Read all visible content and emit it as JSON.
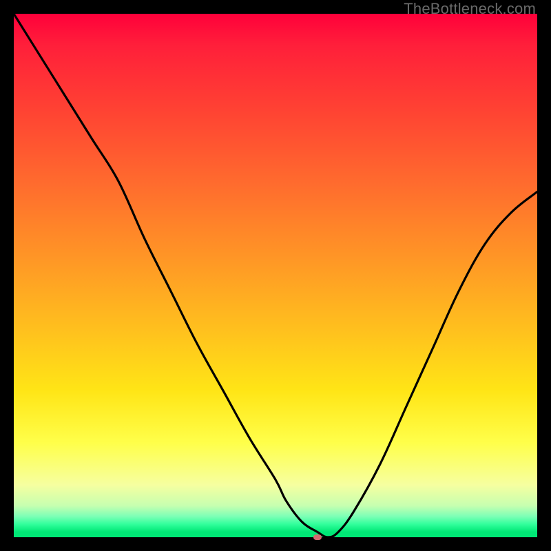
{
  "watermark": "TheBottleneck.com",
  "colors": {
    "curve": "#000000",
    "dot": "#d2686f",
    "frame": "#000000"
  },
  "chart_data": {
    "type": "line",
    "title": "",
    "xlabel": "",
    "ylabel": "",
    "xlim": [
      0,
      100
    ],
    "ylim": [
      0,
      100
    ],
    "series": [
      {
        "name": "curve",
        "x": [
          0,
          5,
          10,
          15,
          20,
          25,
          30,
          35,
          40,
          45,
          50,
          52,
          55,
          58,
          60,
          62,
          65,
          70,
          75,
          80,
          85,
          90,
          95,
          100
        ],
        "y": [
          100,
          92,
          84,
          76,
          68,
          57,
          47,
          37,
          28,
          19,
          11,
          7,
          3,
          1,
          0,
          1,
          5,
          14,
          25,
          36,
          47,
          56,
          62,
          66
        ]
      }
    ],
    "marker": {
      "x": 58,
      "y": 0
    },
    "grid": false,
    "legend": false
  }
}
